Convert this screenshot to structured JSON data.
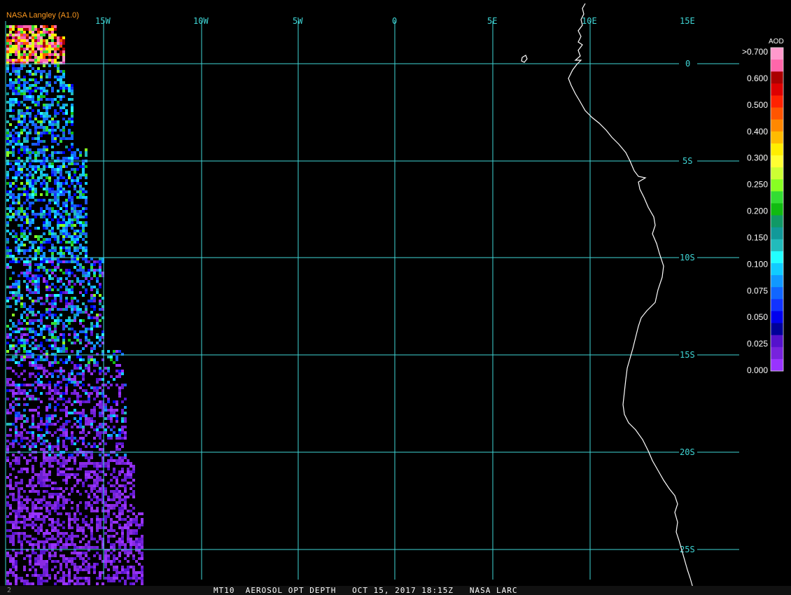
{
  "credit": "NASA Langley (A1.0)",
  "footer": {
    "corner": "2",
    "caption": "MT10  AEROSOL OPT DEPTH   OCT 15, 2017 18:15Z   NASA LARC"
  },
  "grid": {
    "lon_labels": [
      "15W",
      "10W",
      "5W",
      "0",
      "5E",
      "10E",
      "15E"
    ],
    "lat_labels": [
      "0",
      "5S",
      "10S",
      "15S",
      "20S",
      "25S"
    ],
    "line_color": "#3fd6d6"
  },
  "legend": {
    "title": "AOD",
    "labels": [
      ">0.700",
      "0.600",
      "0.500",
      "0.400",
      "0.300",
      "0.250",
      "0.200",
      "0.150",
      "0.100",
      "0.075",
      "0.050",
      "0.025",
      "0.000"
    ],
    "colors": [
      "#ff99cc",
      "#ff66aa",
      "#aa0000",
      "#dd0000",
      "#ff2200",
      "#ff5500",
      "#ff8800",
      "#ffbb00",
      "#ffee00",
      "#ffff33",
      "#ccff33",
      "#88ff22",
      "#33dd33",
      "#11bb11",
      "#119966",
      "#119999",
      "#22bbbb",
      "#22ffff",
      "#11ccff",
      "#1199ff",
      "#1166ff",
      "#1133ff",
      "#0000ee",
      "#000099",
      "#5511cc",
      "#7722dd",
      "#9933ff"
    ]
  },
  "colors": {
    "background": "#000000",
    "coastline": "#ffffff",
    "credit": "#ff9a1f",
    "aod_dominant": "#8a2be2"
  }
}
